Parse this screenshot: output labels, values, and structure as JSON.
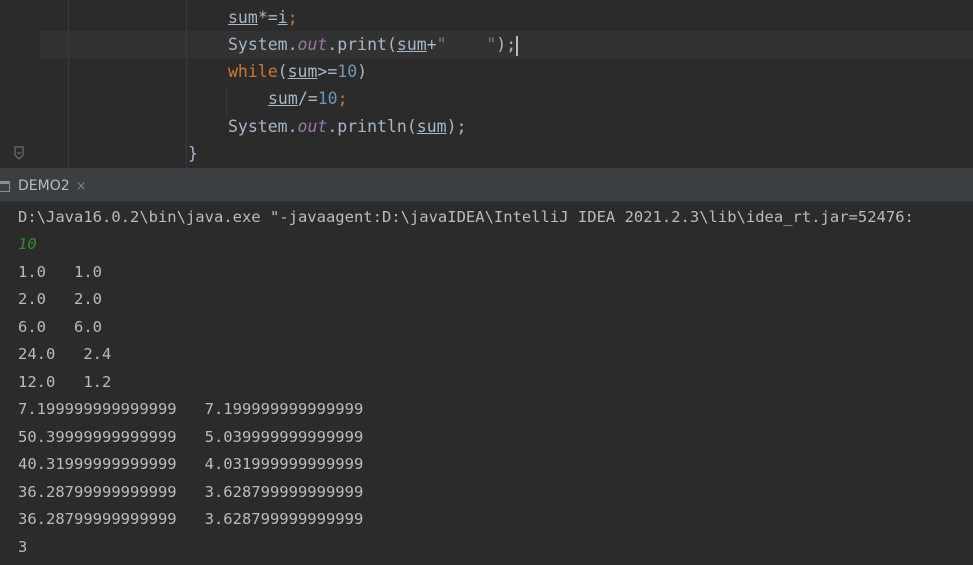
{
  "editor": {
    "lines": {
      "l1": {
        "var": "sum",
        "op": "*=",
        "id": "i",
        "end": ";"
      },
      "l2": {
        "cls": "System.",
        "field": "out",
        "method": ".print(",
        "var": "sum",
        "plus": "+",
        "str": "\"    \"",
        "end": ");"
      },
      "l3": {
        "kw": "while",
        "open": "(",
        "var": "sum",
        "op": ">=",
        "num": "10",
        "close": ")"
      },
      "l4": {
        "var": "sum",
        "op": "/=",
        "num": "10",
        "end": ";"
      },
      "l5": {
        "cls": "System.",
        "field": "out",
        "method": ".println(",
        "var": "sum",
        "end": ");"
      },
      "l6": {
        "brace": "}"
      }
    }
  },
  "run_tab": {
    "label": "DEMO2",
    "close": "×",
    "icon": "run-window-icon"
  },
  "console": {
    "command": "D:\\Java16.0.2\\bin\\java.exe \"-javaagent:D:\\javaIDEA\\IntelliJ IDEA 2021.2.3\\lib\\idea_rt.jar=52476:",
    "input": "10",
    "output": [
      "1.0   1.0",
      "2.0   2.0",
      "6.0   6.0",
      "24.0   2.4",
      "12.0   1.2",
      "7.199999999999999   7.199999999999999",
      "50.39999999999999   5.039999999999999",
      "40.31999999999999   4.031999999999999",
      "36.28799999999999   3.628799999999999",
      "36.28799999999999   3.628799999999999",
      "3"
    ]
  },
  "colors": {
    "background": "#2b2b2b",
    "keyword": "#cc7832",
    "number": "#6897bb",
    "field": "#9876aa",
    "string": "#6a8759",
    "input": "#2e8b2e"
  }
}
